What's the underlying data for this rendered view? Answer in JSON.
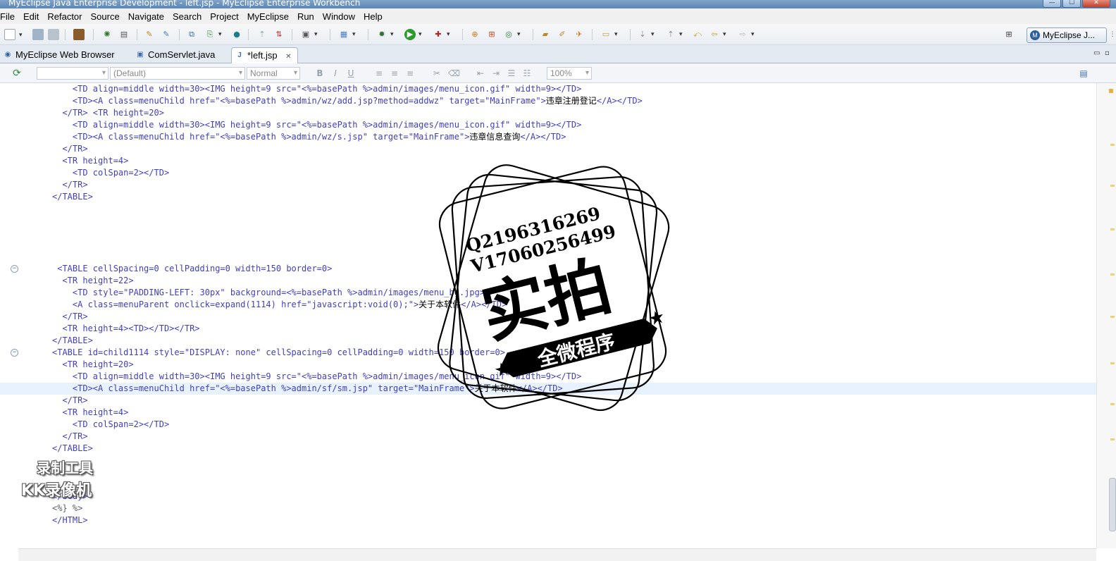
{
  "window": {
    "title": "MyEclipse Java Enterprise Development - left.jsp - MyEclipse Enterprise Workbench",
    "controls": [
      "—",
      "☐",
      "✕"
    ]
  },
  "menu": [
    "File",
    "Edit",
    "Refactor",
    "Source",
    "Navigate",
    "Search",
    "Project",
    "MyEclipse",
    "Run",
    "Window",
    "Help"
  ],
  "toolbar": {
    "perspective_label": "MyEclipse J...",
    "perspective_icon": "M"
  },
  "tabs": [
    {
      "label": "MyEclipse Web Browser",
      "icon": "globe-icon",
      "glyph": "◉"
    },
    {
      "label": "ComServlet.java",
      "icon": "java-file-icon",
      "glyph": "▣"
    },
    {
      "label": "*left.jsp",
      "icon": "jsp-file-icon",
      "glyph": "J",
      "close": "✕"
    }
  ],
  "tab_controls": {
    "minimize": "▭",
    "maximize": "▫"
  },
  "format_bar": {
    "font_combo": "(Default)",
    "style_combo": "Normal",
    "zoom": "100%",
    "bold": "B",
    "italic": "I",
    "underline": "U"
  },
  "code_lines": [
    {
      "segments": [
        {
          "t": "    <TD align=middle width=30><IMG height=9 src=\"<%=basePath %>admin/images/menu_icon.gif\" width=9></TD>",
          "c": "tag"
        }
      ]
    },
    {
      "segments": [
        {
          "t": "    <TD><A class=menuChild href=\"<%=basePath %>admin/wz/add.jsp?method=addwz\" target=\"MainFrame\">",
          "c": "tag"
        },
        {
          "t": "违章注册登记",
          "c": "cjk"
        },
        {
          "t": "</A></TD>",
          "c": "tag"
        }
      ]
    },
    {
      "segments": [
        {
          "t": "  </TR> <TR height=20>",
          "c": "tag"
        }
      ]
    },
    {
      "segments": [
        {
          "t": "    <TD align=middle width=30><IMG height=9 src=\"<%=basePath %>admin/images/menu_icon.gif\" width=9></TD>",
          "c": "tag"
        }
      ]
    },
    {
      "segments": [
        {
          "t": "    <TD><A class=menuChild href=\"<%=basePath %>admin/wz/s.jsp\" target=\"MainFrame\">",
          "c": "tag"
        },
        {
          "t": "违章信息查询",
          "c": "cjk"
        },
        {
          "t": "</A></TD>",
          "c": "tag"
        }
      ]
    },
    {
      "segments": [
        {
          "t": "  </TR>",
          "c": "tag"
        }
      ]
    },
    {
      "segments": [
        {
          "t": "  <TR height=4>",
          "c": "tag"
        }
      ]
    },
    {
      "segments": [
        {
          "t": "    <TD colSpan=2></TD>",
          "c": "tag"
        }
      ]
    },
    {
      "segments": [
        {
          "t": "  </TR>",
          "c": "tag"
        }
      ]
    },
    {
      "segments": [
        {
          "t": "</TABLE>",
          "c": "tag"
        }
      ]
    },
    {
      "segments": [
        {
          "t": "",
          "c": "tag"
        }
      ]
    },
    {
      "segments": [
        {
          "t": "",
          "c": "tag"
        }
      ]
    },
    {
      "segments": [
        {
          "t": "",
          "c": "tag"
        }
      ]
    },
    {
      "segments": [
        {
          "t": "",
          "c": "tag"
        }
      ]
    },
    {
      "segments": [
        {
          "t": "",
          "c": "tag"
        }
      ]
    },
    {
      "segments": [
        {
          "t": " <TABLE cellSpacing=0 cellPadding=0 width=150 border=0>",
          "c": "tag"
        }
      ],
      "fold": true
    },
    {
      "segments": [
        {
          "t": "  <TR height=22>",
          "c": "tag"
        }
      ]
    },
    {
      "segments": [
        {
          "t": "    <TD style=\"PADDING-LEFT: 30px\" background=<%=basePath %>admin/images/menu_bg.jpg>",
          "c": "tag"
        }
      ]
    },
    {
      "segments": [
        {
          "t": "    <A class=menuParent onclick=expand(1114) href=\"javascript:void(0);\">",
          "c": "tag"
        },
        {
          "t": "关于本软件",
          "c": "cjk"
        },
        {
          "t": "</A></TD>",
          "c": "tag"
        }
      ]
    },
    {
      "segments": [
        {
          "t": "  </TR>",
          "c": "tag"
        }
      ]
    },
    {
      "segments": [
        {
          "t": "  <TR height=4><TD></TD></TR>",
          "c": "tag"
        }
      ]
    },
    {
      "segments": [
        {
          "t": "</TABLE>",
          "c": "tag"
        }
      ]
    },
    {
      "segments": [
        {
          "t": "<TABLE id=child1114 style=\"DISPLAY: none\" cellSpacing=0 cellPadding=0 width=150 border=0>",
          "c": "tag"
        }
      ],
      "fold": true
    },
    {
      "segments": [
        {
          "t": "  <TR height=20>",
          "c": "tag"
        }
      ]
    },
    {
      "segments": [
        {
          "t": "    <TD align=middle width=30><IMG height=9 src=\"<%=basePath %>admin/images/menu_icon.gif\" width=9></TD>",
          "c": "tag"
        }
      ]
    },
    {
      "segments": [
        {
          "t": "    <TD><A class=menuChild href=\"<%=basePath %>admin/sf/sm.jsp\" target=\"MainFrame\">",
          "c": "tag"
        },
        {
          "t": "关于本软件",
          "c": "cjk"
        },
        {
          "t": "</A></TD>",
          "c": "tag"
        }
      ],
      "current": true
    },
    {
      "segments": [
        {
          "t": "  </TR>",
          "c": "tag"
        }
      ]
    },
    {
      "segments": [
        {
          "t": "  <TR height=4>",
          "c": "tag"
        }
      ]
    },
    {
      "segments": [
        {
          "t": "    <TD colSpan=2></TD>",
          "c": "tag"
        }
      ]
    },
    {
      "segments": [
        {
          "t": "  </TR>",
          "c": "tag"
        }
      ]
    },
    {
      "segments": [
        {
          "t": "</TABLE>",
          "c": "tag"
        }
      ]
    },
    {
      "segments": [
        {
          "t": "",
          "c": "tag"
        }
      ]
    },
    {
      "segments": [
        {
          "t": "",
          "c": "tag"
        }
      ]
    },
    {
      "segments": [
        {
          "t": "",
          "c": "tag"
        }
      ]
    },
    {
      "segments": [
        {
          "t": "</body>",
          "c": "tag"
        }
      ]
    },
    {
      "segments": [
        {
          "t": "<%} %>",
          "c": "jsp"
        }
      ]
    },
    {
      "segments": [
        {
          "t": "</HTML>",
          "c": "tag"
        }
      ]
    }
  ],
  "stamp": {
    "qq": "Q2196316269",
    "wechat": "V17060256499",
    "big": "实拍",
    "banner": "全微程序"
  },
  "recorder": {
    "line1": "录制工具",
    "line2": "KK录像机"
  }
}
